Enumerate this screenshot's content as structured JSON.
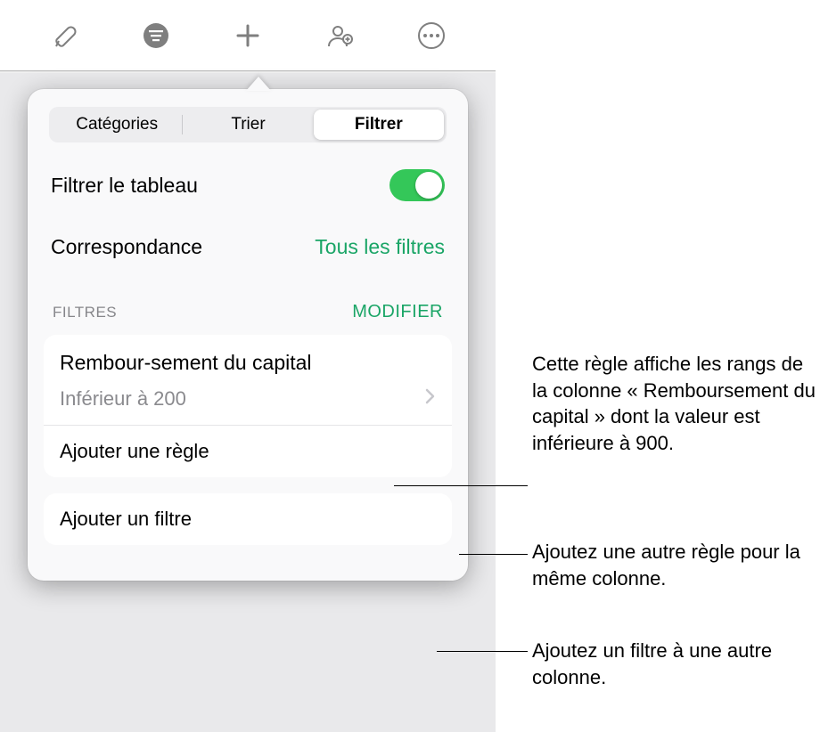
{
  "toolbar": {
    "icons": [
      "format-brush-icon",
      "organize-icon",
      "add-icon",
      "collaborate-icon",
      "more-icon"
    ]
  },
  "popover": {
    "tabs": {
      "categories": "Catégories",
      "sort": "Trier",
      "filter": "Filtrer"
    },
    "filter_table_label": "Filtrer le tableau",
    "filter_table_on": true,
    "match_label": "Correspondance",
    "match_value": "Tous les filtres",
    "section_title": "Filtres",
    "section_action": "MODIFIER",
    "rule": {
      "column": "Rembour-sement du capital",
      "condition": "Inférieur à 200"
    },
    "add_rule_label": "Ajouter une règle",
    "add_filter_label": "Ajouter un filtre"
  },
  "callouts": {
    "c1": "Cette règle affiche les rangs de la colonne « Remboursement du capital » dont la valeur est inférieure à 900.",
    "c2": "Ajoutez une autre règle pour la même colonne.",
    "c3": "Ajoutez un filtre à une autre colonne."
  },
  "colors": {
    "accent": "#1aa566",
    "toggle_on": "#34c759"
  }
}
